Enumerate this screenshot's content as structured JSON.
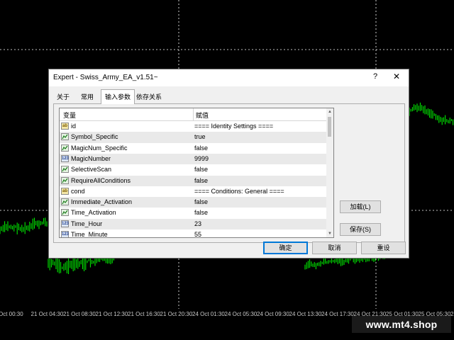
{
  "window": {
    "title": "Expert - Swiss_Army_EA_v1.51~",
    "help_label": "?",
    "close_label": "✕"
  },
  "tabs": [
    {
      "label": "关于"
    },
    {
      "label": "常用"
    },
    {
      "label": "输入参数"
    },
    {
      "label": "依存关系"
    }
  ],
  "active_tab": "输入参数",
  "table": {
    "headers": {
      "variable": "变量",
      "value": "赋值"
    },
    "rows": [
      {
        "icon": "ab",
        "icon_label": "ab",
        "name": "id",
        "value": "==== Identity Settings ===="
      },
      {
        "icon": "bool",
        "name": "Symbol_Specific",
        "value": "true"
      },
      {
        "icon": "bool",
        "name": "MagicNum_Specific",
        "value": "false"
      },
      {
        "icon": "123",
        "icon_label": "123",
        "name": "MagicNumber",
        "value": "9999"
      },
      {
        "icon": "bool",
        "name": "SelectiveScan",
        "value": "false"
      },
      {
        "icon": "bool",
        "name": "RequireAllConditions",
        "value": "false"
      },
      {
        "icon": "ab",
        "icon_label": "ab",
        "name": "cond",
        "value": "==== Conditions: General ===="
      },
      {
        "icon": "bool",
        "name": "Immediate_Activation",
        "value": "false"
      },
      {
        "icon": "bool",
        "name": "Time_Activation",
        "value": "false"
      },
      {
        "icon": "123",
        "icon_label": "123",
        "name": "Time_Hour",
        "value": "23"
      },
      {
        "icon": "123",
        "icon_label": "123",
        "name": "Time_Minute",
        "value": "55"
      }
    ]
  },
  "buttons": {
    "load": "加载(L)",
    "save": "保存(S)",
    "ok": "确定",
    "cancel": "取消",
    "reset": "重设"
  },
  "time_axis": [
    "Oct 00:30",
    "21 Oct 04:30",
    "21 Oct 08:30",
    "21 Oct 12:30",
    "21 Oct 16:30",
    "21 Oct 20:30",
    "24 Oct 01:30",
    "24 Oct 05:30",
    "24 Oct 09:30",
    "24 Oct 13:30",
    "24 Oct 17:30",
    "24 Oct 21:30",
    "25 Oct 01:30",
    "25 Oct 05:30",
    "25 Oct"
  ],
  "watermark": "www.mt4.shop",
  "colors": {
    "candle": "#00ff00",
    "background": "#000000",
    "grid": "#ffffff"
  }
}
